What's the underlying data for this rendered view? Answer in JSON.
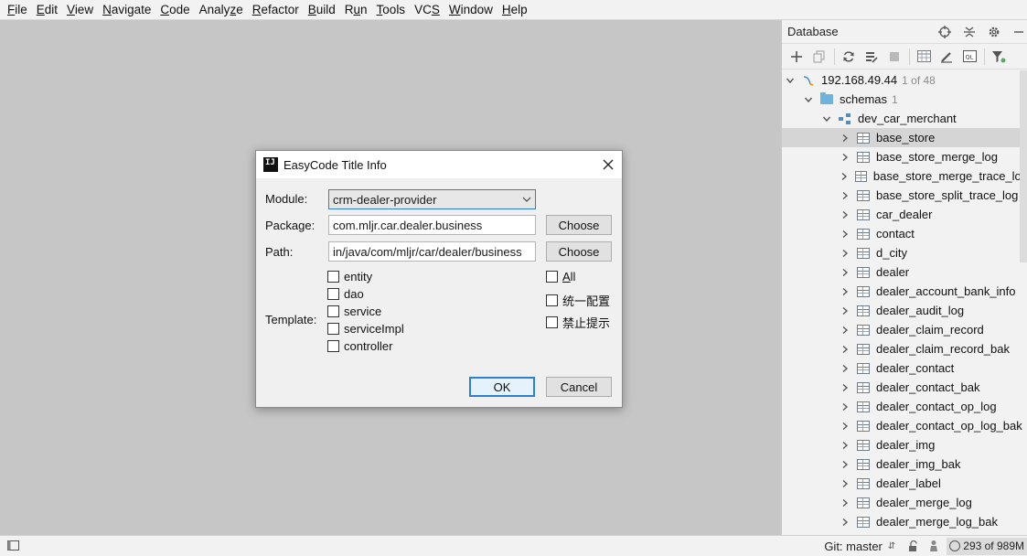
{
  "menu": [
    {
      "u": "F",
      "rest": "ile"
    },
    {
      "u": "E",
      "rest": "dit"
    },
    {
      "u": "V",
      "rest": "iew"
    },
    {
      "u": "N",
      "rest": "avigate"
    },
    {
      "u": "C",
      "rest": "ode"
    },
    {
      "pre": "Analy",
      "u": "z",
      "rest": "e"
    },
    {
      "u": "R",
      "rest": "efactor"
    },
    {
      "u": "B",
      "rest": "uild"
    },
    {
      "pre": "R",
      "u": "u",
      "rest": "n"
    },
    {
      "u": "T",
      "rest": "ools"
    },
    {
      "pre": "VC",
      "u": "S",
      "rest": ""
    },
    {
      "u": "W",
      "rest": "indow"
    },
    {
      "u": "H",
      "rest": "elp"
    }
  ],
  "database_panel": {
    "title": "Database",
    "connection": {
      "label": "192.168.49.44",
      "count": "1 of 48"
    },
    "schemas": {
      "label": "schemas",
      "count": "1"
    },
    "schema": "dev_car_merchant",
    "selected_table": "base_store",
    "tables": [
      "base_store",
      "base_store_merge_log",
      "base_store_merge_trace_log",
      "base_store_split_trace_log",
      "car_dealer",
      "contact",
      "d_city",
      "dealer",
      "dealer_account_bank_info",
      "dealer_audit_log",
      "dealer_claim_record",
      "dealer_claim_record_bak",
      "dealer_contact",
      "dealer_contact_bak",
      "dealer_contact_op_log",
      "dealer_contact_op_log_bak",
      "dealer_img",
      "dealer_img_bak",
      "dealer_label",
      "dealer_merge_log",
      "dealer_merge_log_bak"
    ]
  },
  "statusbar": {
    "git": "Git: master",
    "memory": "293 of 989M"
  },
  "dialog": {
    "title": "EasyCode Title Info",
    "logo": "IJ",
    "module_label": "Module:",
    "module_value": "crm-dealer-provider",
    "package_label": "Package:",
    "package_value": "com.mljr.car.dealer.business",
    "path_label": "Path:",
    "path_value": "in/java/com/mljr/car/dealer/business",
    "choose_label": "Choose",
    "template_label": "Template:",
    "templates": [
      {
        "label": "entity",
        "checked": false
      },
      {
        "label": "dao",
        "checked": false
      },
      {
        "label": "service",
        "checked": false
      },
      {
        "label": "serviceImpl",
        "checked": false
      },
      {
        "label": "controller",
        "checked": false
      }
    ],
    "options": [
      {
        "pre": "",
        "u": "A",
        "rest": "ll",
        "checked": false
      },
      {
        "pre": "统一配置",
        "u": "",
        "rest": "",
        "checked": false
      },
      {
        "pre": "禁止提示",
        "u": "",
        "rest": "",
        "checked": false
      }
    ],
    "ok_label": "OK",
    "cancel_label": "Cancel"
  },
  "colors": {
    "accent": "#2f7fd0",
    "editor_bg": "#c6c6c6",
    "panel_bg": "#f2f2f2",
    "selection": "#d5d5d5"
  }
}
